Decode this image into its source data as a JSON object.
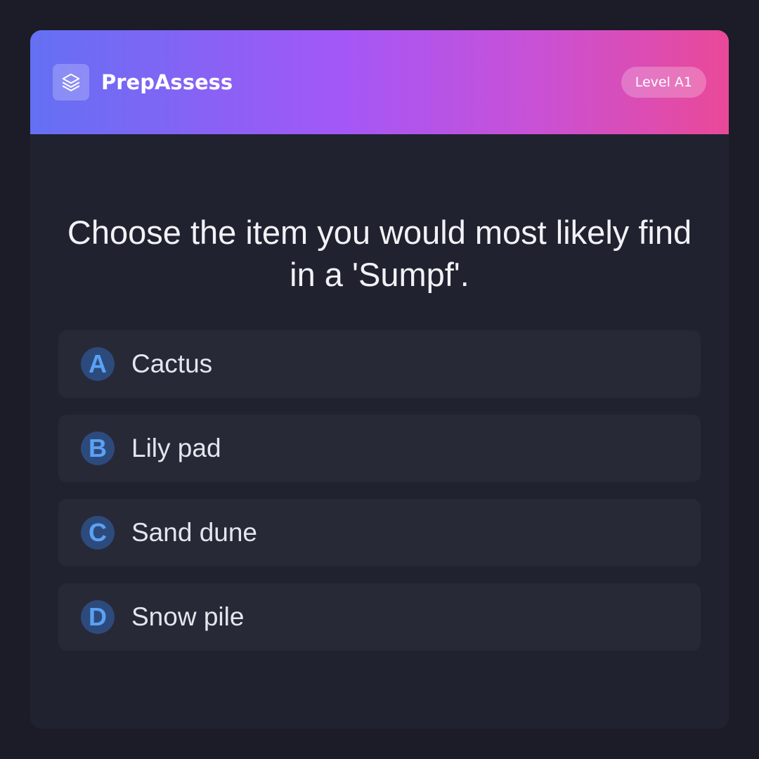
{
  "app": {
    "brand": "PrepAssess",
    "logo_icon": "layers-icon",
    "level_badge": "Level A1"
  },
  "question": {
    "text": "Choose the item you would most likely find in a 'Sumpf'."
  },
  "options": [
    {
      "letter": "A",
      "text": "Cactus"
    },
    {
      "letter": "B",
      "text": "Lily pad"
    },
    {
      "letter": "C",
      "text": "Sand dune"
    },
    {
      "letter": "D",
      "text": "Snow pile"
    }
  ],
  "colors": {
    "page_background": "#1b1c28",
    "card_background": "#20222f",
    "option_background": "#272937",
    "header_gradient": [
      "#6470f3",
      "#a457f6",
      "#c851d6",
      "#ea4998"
    ],
    "letter_circle": "#2d4a7c",
    "letter_text": "#5aa1f4"
  }
}
